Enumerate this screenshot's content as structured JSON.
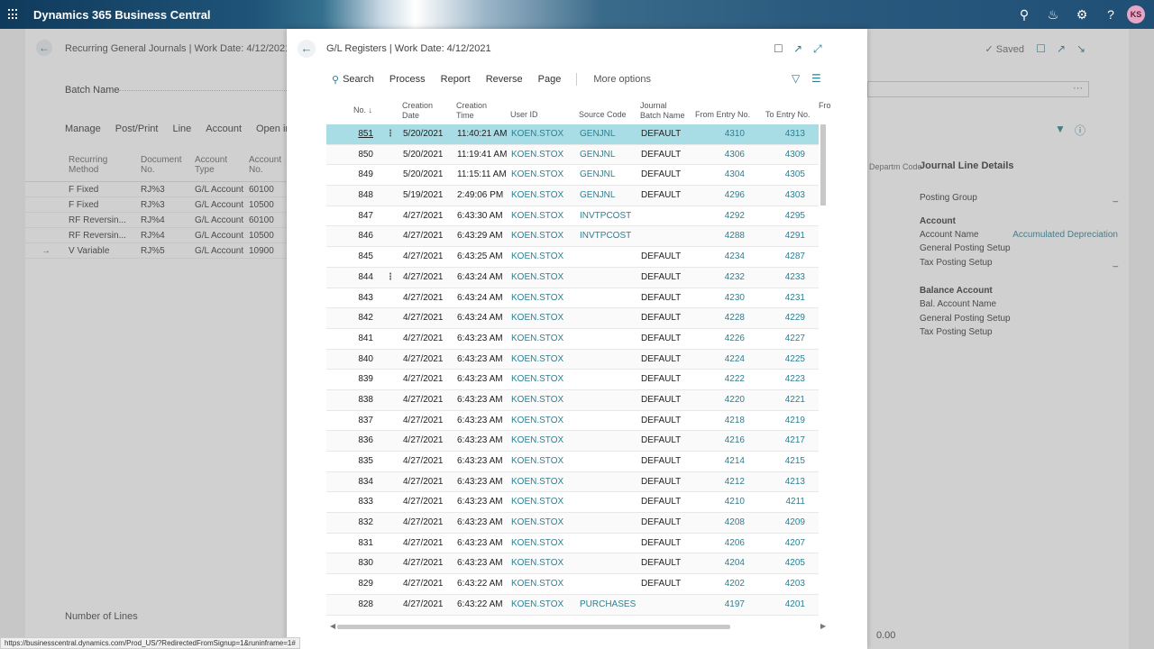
{
  "app": {
    "title": "Dynamics 365 Business Central",
    "avatar_initials": "KS"
  },
  "background_page": {
    "title": "Recurring General Journals | Work Date: 4/12/2021",
    "saved_label": "Saved",
    "batch_label": "Batch Name",
    "actions": [
      "Manage",
      "Post/Print",
      "Line",
      "Account",
      "Open in"
    ],
    "table_headers": [
      "Recurring Method",
      "Document No.",
      "Account Type",
      "Account No."
    ],
    "rows": [
      [
        "F  Fixed",
        "RJ%3",
        "G/L Account",
        "60100"
      ],
      [
        "F  Fixed",
        "RJ%3",
        "G/L Account",
        "10500"
      ],
      [
        "RF Reversin...",
        "RJ%4",
        "G/L Account",
        "60100"
      ],
      [
        "RF Reversin...",
        "RJ%4",
        "G/L Account",
        "10500"
      ],
      [
        "V  Variable",
        "RJ%5",
        "G/L Account",
        "10900"
      ]
    ],
    "dept_label": "Departm Code",
    "details": {
      "title": "Journal Line Details",
      "posting_group": "Posting Group",
      "account_header": "Account",
      "account_name_label": "Account Name",
      "account_name_value": "Accumulated Depreciation",
      "gen_posting_setup": "General Posting Setup",
      "tax_posting_setup": "Tax Posting Setup",
      "balance_header": "Balance Account",
      "bal_account_name": "Bal. Account Name",
      "bal_gen_posting_setup": "General Posting Setup",
      "bal_tax_posting_setup": "Tax Posting Setup"
    },
    "number_of_lines": "Number of Lines",
    "total_value": "0.00"
  },
  "modal": {
    "title": "G/L Registers | Work Date: 4/12/2021",
    "actions": {
      "search": "Search",
      "process": "Process",
      "report": "Report",
      "reverse": "Reverse",
      "page": "Page",
      "more": "More options"
    },
    "headers": {
      "no": "No. ↓",
      "creation_date_1": "Creation",
      "creation_date_2": "Date",
      "creation_time_1": "Creation",
      "creation_time_2": "Time",
      "user_id": "User ID",
      "source_code": "Source Code",
      "batch_1": "Journal",
      "batch_2": "Batch Name",
      "from_entry": "From Entry No.",
      "to_entry": "To Entry No.",
      "extra": "Fro"
    },
    "rows": [
      {
        "no": "851",
        "date": "5/20/2021",
        "time": "11:40:21 AM",
        "user": "KOEN.STOX",
        "src": "GENJNL",
        "batch": "DEFAULT",
        "from": "4310",
        "to": "4313"
      },
      {
        "no": "850",
        "date": "5/20/2021",
        "time": "11:19:41 AM",
        "user": "KOEN.STOX",
        "src": "GENJNL",
        "batch": "DEFAULT",
        "from": "4306",
        "to": "4309"
      },
      {
        "no": "849",
        "date": "5/20/2021",
        "time": "11:15:11 AM",
        "user": "KOEN.STOX",
        "src": "GENJNL",
        "batch": "DEFAULT",
        "from": "4304",
        "to": "4305"
      },
      {
        "no": "848",
        "date": "5/19/2021",
        "time": "2:49:06 PM",
        "user": "KOEN.STOX",
        "src": "GENJNL",
        "batch": "DEFAULT",
        "from": "4296",
        "to": "4303"
      },
      {
        "no": "847",
        "date": "4/27/2021",
        "time": "6:43:30 AM",
        "user": "KOEN.STOX",
        "src": "INVTPCOST",
        "batch": "",
        "from": "4292",
        "to": "4295"
      },
      {
        "no": "846",
        "date": "4/27/2021",
        "time": "6:43:29 AM",
        "user": "KOEN.STOX",
        "src": "INVTPCOST",
        "batch": "",
        "from": "4288",
        "to": "4291"
      },
      {
        "no": "845",
        "date": "4/27/2021",
        "time": "6:43:25 AM",
        "user": "KOEN.STOX",
        "src": "",
        "batch": "DEFAULT",
        "from": "4234",
        "to": "4287"
      },
      {
        "no": "844",
        "date": "4/27/2021",
        "time": "6:43:24 AM",
        "user": "KOEN.STOX",
        "src": "",
        "batch": "DEFAULT",
        "from": "4232",
        "to": "4233"
      },
      {
        "no": "843",
        "date": "4/27/2021",
        "time": "6:43:24 AM",
        "user": "KOEN.STOX",
        "src": "",
        "batch": "DEFAULT",
        "from": "4230",
        "to": "4231"
      },
      {
        "no": "842",
        "date": "4/27/2021",
        "time": "6:43:24 AM",
        "user": "KOEN.STOX",
        "src": "",
        "batch": "DEFAULT",
        "from": "4228",
        "to": "4229"
      },
      {
        "no": "841",
        "date": "4/27/2021",
        "time": "6:43:23 AM",
        "user": "KOEN.STOX",
        "src": "",
        "batch": "DEFAULT",
        "from": "4226",
        "to": "4227"
      },
      {
        "no": "840",
        "date": "4/27/2021",
        "time": "6:43:23 AM",
        "user": "KOEN.STOX",
        "src": "",
        "batch": "DEFAULT",
        "from": "4224",
        "to": "4225"
      },
      {
        "no": "839",
        "date": "4/27/2021",
        "time": "6:43:23 AM",
        "user": "KOEN.STOX",
        "src": "",
        "batch": "DEFAULT",
        "from": "4222",
        "to": "4223"
      },
      {
        "no": "838",
        "date": "4/27/2021",
        "time": "6:43:23 AM",
        "user": "KOEN.STOX",
        "src": "",
        "batch": "DEFAULT",
        "from": "4220",
        "to": "4221"
      },
      {
        "no": "837",
        "date": "4/27/2021",
        "time": "6:43:23 AM",
        "user": "KOEN.STOX",
        "src": "",
        "batch": "DEFAULT",
        "from": "4218",
        "to": "4219"
      },
      {
        "no": "836",
        "date": "4/27/2021",
        "time": "6:43:23 AM",
        "user": "KOEN.STOX",
        "src": "",
        "batch": "DEFAULT",
        "from": "4216",
        "to": "4217"
      },
      {
        "no": "835",
        "date": "4/27/2021",
        "time": "6:43:23 AM",
        "user": "KOEN.STOX",
        "src": "",
        "batch": "DEFAULT",
        "from": "4214",
        "to": "4215"
      },
      {
        "no": "834",
        "date": "4/27/2021",
        "time": "6:43:23 AM",
        "user": "KOEN.STOX",
        "src": "",
        "batch": "DEFAULT",
        "from": "4212",
        "to": "4213"
      },
      {
        "no": "833",
        "date": "4/27/2021",
        "time": "6:43:23 AM",
        "user": "KOEN.STOX",
        "src": "",
        "batch": "DEFAULT",
        "from": "4210",
        "to": "4211"
      },
      {
        "no": "832",
        "date": "4/27/2021",
        "time": "6:43:23 AM",
        "user": "KOEN.STOX",
        "src": "",
        "batch": "DEFAULT",
        "from": "4208",
        "to": "4209"
      },
      {
        "no": "831",
        "date": "4/27/2021",
        "time": "6:43:23 AM",
        "user": "KOEN.STOX",
        "src": "",
        "batch": "DEFAULT",
        "from": "4206",
        "to": "4207"
      },
      {
        "no": "830",
        "date": "4/27/2021",
        "time": "6:43:23 AM",
        "user": "KOEN.STOX",
        "src": "",
        "batch": "DEFAULT",
        "from": "4204",
        "to": "4205"
      },
      {
        "no": "829",
        "date": "4/27/2021",
        "time": "6:43:22 AM",
        "user": "KOEN.STOX",
        "src": "",
        "batch": "DEFAULT",
        "from": "4202",
        "to": "4203"
      },
      {
        "no": "828",
        "date": "4/27/2021",
        "time": "6:43:22 AM",
        "user": "KOEN.STOX",
        "src": "PURCHASES",
        "batch": "",
        "from": "4197",
        "to": "4201"
      }
    ]
  },
  "status_url": "https://businesscentral.dynamics.com/Prod_US/?RedirectedFromSignup=1&runinframe=1#",
  "colors": {
    "accent": "#2e7f90",
    "selected_row": "#a9dde6"
  }
}
